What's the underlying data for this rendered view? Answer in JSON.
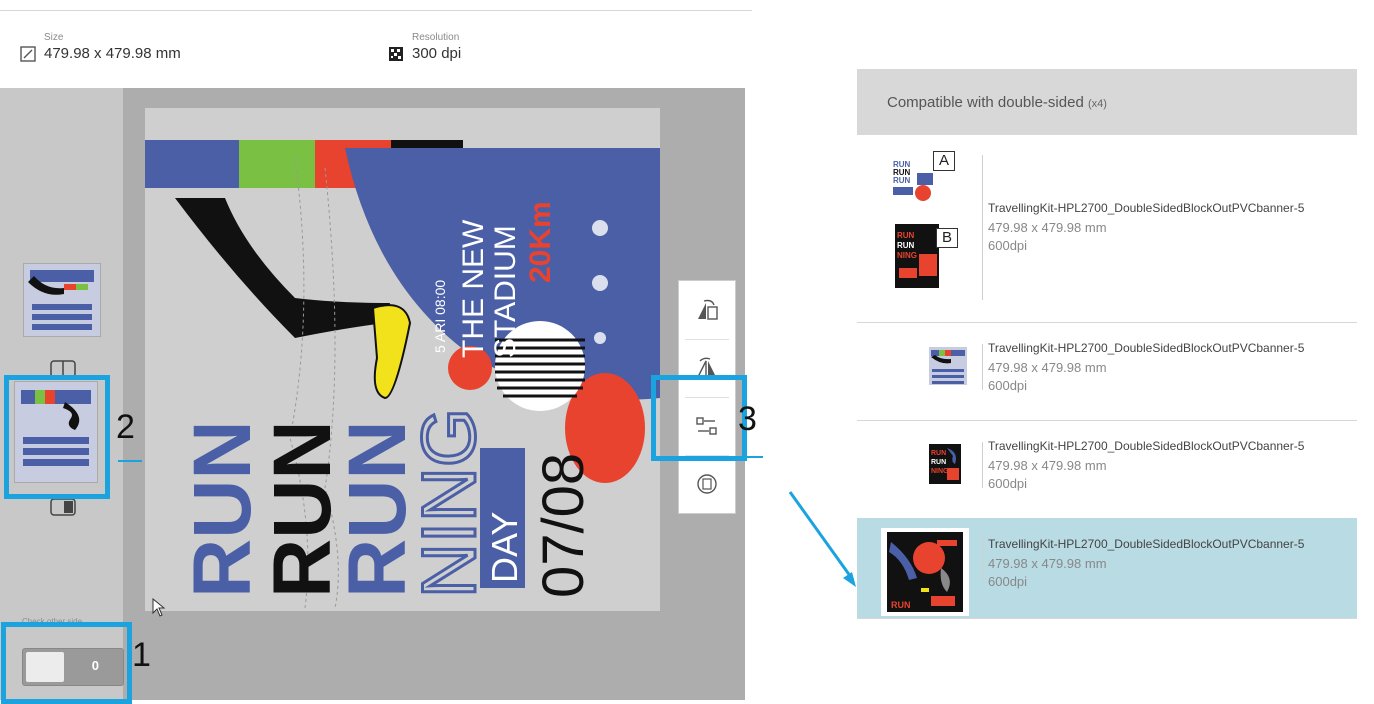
{
  "info": {
    "size_label": "Size",
    "size_value": "479.98 x 479.98 mm",
    "resolution_label": "Resolution",
    "resolution_value": "300 dpi"
  },
  "poster": {
    "word1": "RUN",
    "word2": "RUN",
    "word3": "RUN",
    "word4": "NING",
    "badge": "DAY",
    "date": "07/08",
    "venue1": "THE NEW",
    "venue2": "STADIUM",
    "distance": "20Km",
    "time": "5 ARI 08:00"
  },
  "left_panel": {
    "check_label": "Check other side",
    "toggle_value": "0"
  },
  "markers": {
    "m1": "1",
    "m2": "2",
    "m3": "3"
  },
  "colors": {
    "highlight": "#1aa3df",
    "blue": "#4a5fa6",
    "green": "#7ac143",
    "red": "#e8432e",
    "selected_row": "#b9dbe4"
  },
  "tools": [
    "rotate-left-icon",
    "rotate-right-icon",
    "swap-sides-icon",
    "flip-icon"
  ],
  "file_list": {
    "header": "Compatible with double-sided",
    "header_count": "(x4)",
    "side_a": "A",
    "side_b": "B",
    "rows": [
      {
        "name": "TravellingKit-HPL2700_DoubleSidedBlockOutPVCbanner-5",
        "size": "479.98 x 479.98 mm",
        "dpi": "600dpi"
      },
      {
        "name": "TravellingKit-HPL2700_DoubleSidedBlockOutPVCbanner-5",
        "size": "479.98 x 479.98 mm",
        "dpi": "600dpi"
      },
      {
        "name": "TravellingKit-HPL2700_DoubleSidedBlockOutPVCbanner-5",
        "size": "479.98 x 479.98 mm",
        "dpi": "600dpi"
      },
      {
        "name": "TravellingKit-HPL2700_DoubleSidedBlockOutPVCbanner-5",
        "size": "479.98 x 479.98 mm",
        "dpi": "600dpi"
      }
    ]
  }
}
